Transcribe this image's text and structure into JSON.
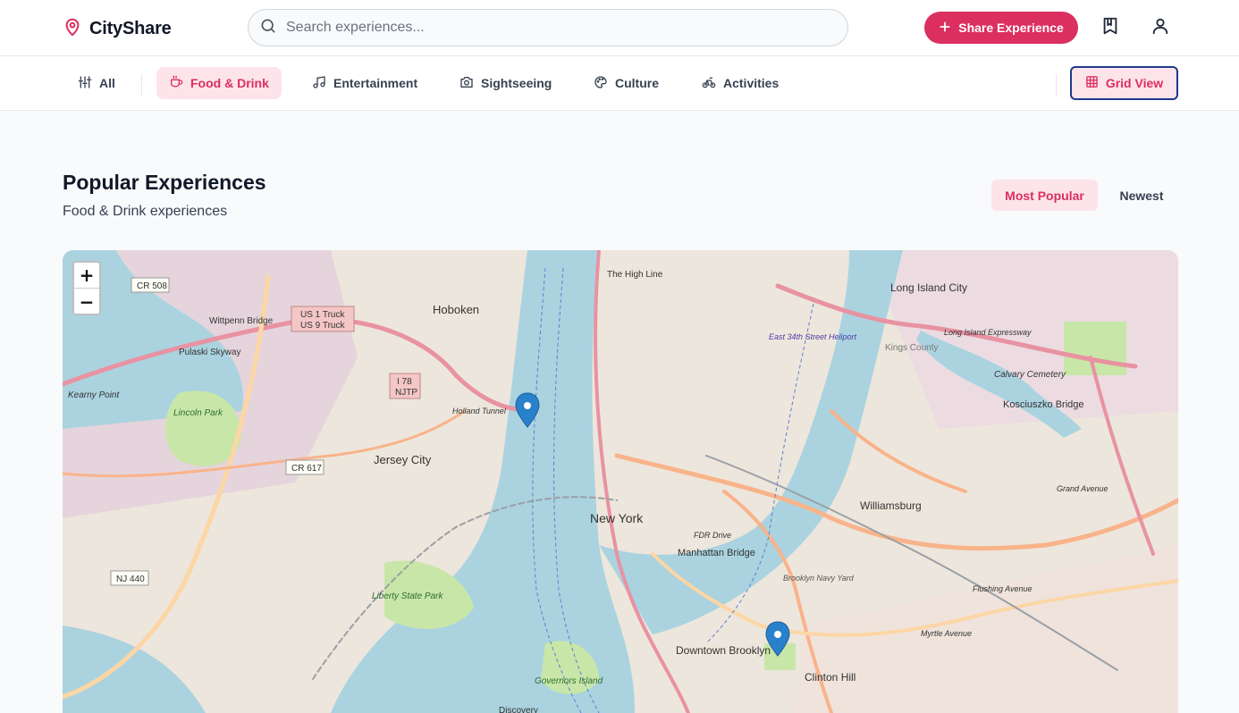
{
  "header": {
    "brand": "CityShare",
    "search_placeholder": "Search experiences...",
    "share_label": "Share Experience",
    "icons": [
      "map-pin-icon",
      "search-icon",
      "plus-icon",
      "bookmark-icon",
      "user-icon"
    ]
  },
  "categories": [
    {
      "label": "All",
      "icon": "sliders-icon"
    },
    {
      "label": "Food & Drink",
      "icon": "coffee-cup-icon",
      "active": true
    },
    {
      "label": "Entertainment",
      "icon": "music-note-icon"
    },
    {
      "label": "Sightseeing",
      "icon": "camera-icon"
    },
    {
      "label": "Culture",
      "icon": "palette-icon"
    },
    {
      "label": "Activities",
      "icon": "bicycle-icon"
    }
  ],
  "view_toggle": {
    "label": "Grid View",
    "icon": "grid-icon"
  },
  "section": {
    "title": "Popular Experiences",
    "subtitle": "Food & Drink experiences"
  },
  "sort": {
    "options": [
      "Most Popular",
      "Newest"
    ],
    "active": "Most Popular"
  },
  "map": {
    "zoom_in": "+",
    "zoom_out": "−",
    "labels": {
      "hoboken": "Hoboken",
      "jersey_city": "Jersey City",
      "new_york": "New York",
      "long_island_city": "Long Island City",
      "williamsburg": "Williamsburg",
      "kosciuszko": "Kosciuszko Bridge",
      "calvary": "Calvary Cemetery",
      "high_line": "The High Line",
      "manhattan_bridge": "Manhattan Bridge",
      "downtown_brooklyn": "Downtown Brooklyn",
      "clinton_hill": "Clinton Hill",
      "liberty_park": "Liberty State Park",
      "governors_island": "Governors Island",
      "wittpenn": "Wittpenn Bridge",
      "pulaski": "Pulaski Skyway",
      "kearny": "Kearny Point",
      "lincoln_park": "Lincoln Park",
      "brooklyn_navy_yard": "Brooklyn Navy Yard",
      "heliport": "East 34th Street Heliport",
      "kings_county": "Kings County",
      "fdr_drive": "FDR Drive",
      "myrtle": "Myrtle Avenue",
      "grand_avenue": "Grand Avenue",
      "flushing": "Flushing Avenue",
      "cr508": "CR 508",
      "cr617": "CR 617",
      "nj440": "NJ 440",
      "us1": "US 1 Truck",
      "us9": "US 9 Truck",
      "i78": "I 78",
      "njtp": "NJTP",
      "holland": "Holland Tunnel",
      "lie": "Long Island Expressway",
      "discovery": "Discovery"
    },
    "markers": [
      {
        "name": "marker-holland-tunnel",
        "color": "#2a81cb"
      },
      {
        "name": "marker-fort-greene",
        "color": "#2a81cb"
      }
    ]
  }
}
